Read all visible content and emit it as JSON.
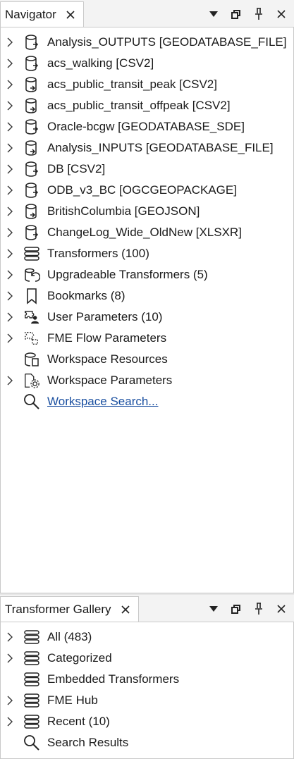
{
  "navigator": {
    "title": "Navigator",
    "items": [
      {
        "label": "Analysis_OUTPUTS [GEODATABASE_FILE]",
        "icon": "reader-db-icon",
        "expandable": true
      },
      {
        "label": "acs_walking [CSV2]",
        "icon": "reader-db-icon",
        "expandable": true
      },
      {
        "label": "acs_public_transit_peak [CSV2]",
        "icon": "writer-db-icon",
        "expandable": true
      },
      {
        "label": "acs_public_transit_offpeak [CSV2]",
        "icon": "writer-db-icon",
        "expandable": true
      },
      {
        "label": "Oracle-bcgw [GEODATABASE_SDE]",
        "icon": "reader-db-icon",
        "expandable": true
      },
      {
        "label": "Analysis_INPUTS [GEODATABASE_FILE]",
        "icon": "writer-db-icon",
        "expandable": true
      },
      {
        "label": "DB [CSV2]",
        "icon": "reader-db-icon",
        "expandable": true
      },
      {
        "label": "ODB_v3_BC [OGCGEOPACKAGE]",
        "icon": "reader-db-icon",
        "expandable": true
      },
      {
        "label": "BritishColumbia [GEOJSON]",
        "icon": "writer-db-icon",
        "expandable": true
      },
      {
        "label": "ChangeLog_Wide_OldNew [XLSXR]",
        "icon": "reader-db-icon",
        "expandable": true
      },
      {
        "label": "Transformers (100)",
        "icon": "transformers-stack-icon",
        "expandable": true
      },
      {
        "label": "Upgradeable Transformers (5)",
        "icon": "upgrade-icon",
        "expandable": true
      },
      {
        "label": "Bookmarks (8)",
        "icon": "bookmark-icon",
        "expandable": true
      },
      {
        "label": "User Parameters (10)",
        "icon": "user-parameters-icon",
        "expandable": true
      },
      {
        "label": "FME Flow Parameters",
        "icon": "flow-parameters-icon",
        "expandable": true
      },
      {
        "label": "Workspace Resources",
        "icon": "resources-icon",
        "expandable": false
      },
      {
        "label": "Workspace Parameters",
        "icon": "workspace-parameters-icon",
        "expandable": true
      },
      {
        "label": "Workspace Search...",
        "icon": "search-icon",
        "expandable": false,
        "link": true
      }
    ]
  },
  "gallery": {
    "title": "Transformer Gallery",
    "items": [
      {
        "label": "All (483)",
        "icon": "transformers-stack-icon",
        "expandable": true
      },
      {
        "label": "Categorized",
        "icon": "transformers-stack-icon",
        "expandable": true
      },
      {
        "label": "Embedded Transformers",
        "icon": "transformers-stack-icon",
        "expandable": false
      },
      {
        "label": "FME Hub",
        "icon": "transformers-stack-icon",
        "expandable": true
      },
      {
        "label": "Recent (10)",
        "icon": "transformers-stack-icon",
        "expandable": true
      },
      {
        "label": "Search Results",
        "icon": "search-icon",
        "expandable": false
      }
    ]
  }
}
